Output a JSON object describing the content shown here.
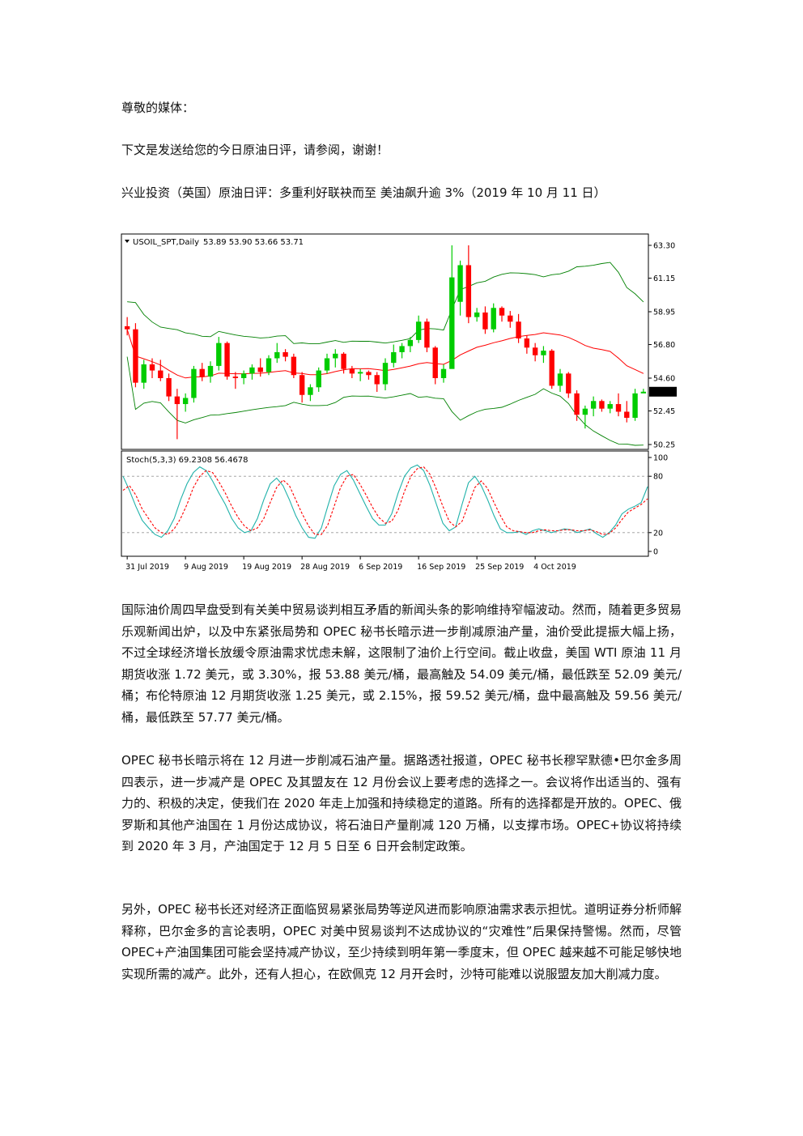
{
  "header": {
    "greeting": "尊敬的媒体：",
    "intro": "下文是发送给您的今日原油日评，请参阅，谢谢！",
    "title": "兴业投资（英国）原油日评：多重利好联袂而至  美油飙升逾 3%（2019 年 10 月 11 日）"
  },
  "chart_data": {
    "type": "candlestick",
    "symbol_label": "USOIL_SPT,Daily",
    "ohlc_label": "53.89 53.90 53.66 53.71",
    "price_ticks": [
      "63.30",
      "61.15",
      "58.95",
      "56.80",
      "54.60",
      "52.45",
      "50.25"
    ],
    "price_range": [
      50.25,
      63.3
    ],
    "current_price": "53.71",
    "date_labels": [
      "31 Jul 2019",
      "9 Aug 2019",
      "19 Aug 2019",
      "28 Aug 2019",
      "6 Sep 2019",
      "16 Sep 2019",
      "25 Sep 2019",
      "4 Oct 2019"
    ],
    "date_label_bar_index": [
      0,
      7,
      14,
      21,
      28,
      35,
      42,
      49
    ],
    "colors": {
      "up": "#00cc00",
      "down": "#ff0000",
      "bands": "#008000",
      "middle": "#ff0000",
      "stoch_main": "#20b2aa",
      "stoch_signal": "#ff0000"
    },
    "candles": [
      [
        58.0,
        58.6,
        57.4,
        57.8
      ],
      [
        57.8,
        58.2,
        54.0,
        54.3
      ],
      [
        54.3,
        55.8,
        53.9,
        55.5
      ],
      [
        55.5,
        55.9,
        54.6,
        55.1
      ],
      [
        55.1,
        55.8,
        54.4,
        54.6
      ],
      [
        54.6,
        54.9,
        53.1,
        53.4
      ],
      [
        53.4,
        53.9,
        50.6,
        52.9
      ],
      [
        52.9,
        53.6,
        52.4,
        53.3
      ],
      [
        53.3,
        55.4,
        53.0,
        55.2
      ],
      [
        55.2,
        55.6,
        54.4,
        54.7
      ],
      [
        54.7,
        55.7,
        54.3,
        55.4
      ],
      [
        55.4,
        57.3,
        55.1,
        56.9
      ],
      [
        56.9,
        57.0,
        54.5,
        54.7
      ],
      [
        54.7,
        55.0,
        53.9,
        54.6
      ],
      [
        54.6,
        55.1,
        54.2,
        54.9
      ],
      [
        54.9,
        55.5,
        54.5,
        55.3
      ],
      [
        55.3,
        55.9,
        54.7,
        55.0
      ],
      [
        55.0,
        56.1,
        54.8,
        55.9
      ],
      [
        55.9,
        56.9,
        55.6,
        56.3
      ],
      [
        56.3,
        56.5,
        55.7,
        56.0
      ],
      [
        56.0,
        56.2,
        54.6,
        54.8
      ],
      [
        54.8,
        55.0,
        53.0,
        53.5
      ],
      [
        53.5,
        54.2,
        53.1,
        54.0
      ],
      [
        54.0,
        55.3,
        53.7,
        55.1
      ],
      [
        55.1,
        56.2,
        54.9,
        55.9
      ],
      [
        55.9,
        56.5,
        55.3,
        56.2
      ],
      [
        56.2,
        56.3,
        54.9,
        55.2
      ],
      [
        55.2,
        55.4,
        54.6,
        54.9
      ],
      [
        54.9,
        55.2,
        54.4,
        55.0
      ],
      [
        55.0,
        55.1,
        54.5,
        54.8
      ],
      [
        54.8,
        55.0,
        53.7,
        54.2
      ],
      [
        54.2,
        55.9,
        53.8,
        55.6
      ],
      [
        55.6,
        56.8,
        55.3,
        56.3
      ],
      [
        56.3,
        56.9,
        55.9,
        56.7
      ],
      [
        56.7,
        57.3,
        56.3,
        57.1
      ],
      [
        57.1,
        58.7,
        56.9,
        58.3
      ],
      [
        58.3,
        58.5,
        56.3,
        56.6
      ],
      [
        56.6,
        56.7,
        54.2,
        54.6
      ],
      [
        54.6,
        55.5,
        54.3,
        55.2
      ],
      [
        55.2,
        63.3,
        60.5,
        61.2
      ],
      [
        59.6,
        62.3,
        58.7,
        62.0
      ],
      [
        62.0,
        63.3,
        58.2,
        58.6
      ],
      [
        58.6,
        59.2,
        58.3,
        58.9
      ],
      [
        58.9,
        59.3,
        57.5,
        57.8
      ],
      [
        57.8,
        59.5,
        57.6,
        59.2
      ],
      [
        59.2,
        59.3,
        58.3,
        58.7
      ],
      [
        58.7,
        59.0,
        57.9,
        58.3
      ],
      [
        58.3,
        58.8,
        56.9,
        57.2
      ],
      [
        57.2,
        57.4,
        56.2,
        56.6
      ],
      [
        56.6,
        56.9,
        55.7,
        56.1
      ],
      [
        56.1,
        56.7,
        55.6,
        56.4
      ],
      [
        56.4,
        56.5,
        53.9,
        54.1
      ],
      [
        54.1,
        55.2,
        53.7,
        54.9
      ],
      [
        54.9,
        55.0,
        53.3,
        53.6
      ],
      [
        53.6,
        53.8,
        51.8,
        52.2
      ],
      [
        52.2,
        52.8,
        51.3,
        52.6
      ],
      [
        52.6,
        53.4,
        52.1,
        53.1
      ],
      [
        53.1,
        53.2,
        52.4,
        52.6
      ],
      [
        52.6,
        53.1,
        52.3,
        52.9
      ],
      [
        52.9,
        53.6,
        52.1,
        52.4
      ],
      [
        52.4,
        53.1,
        51.7,
        52.0
      ],
      [
        52.0,
        53.9,
        51.8,
        53.6
      ],
      [
        53.6,
        53.9,
        53.66,
        53.71
      ]
    ],
    "stoch_label": "Stoch(5,3,3) 69.2308 56.4678",
    "stoch_ticks": [
      "100",
      "80",
      "20",
      "0"
    ],
    "stoch_levels": [
      80,
      20
    ],
    "stoch_main": [
      80,
      65,
      48,
      33,
      25,
      18,
      15,
      22,
      35,
      55,
      72,
      84,
      90,
      86,
      75,
      62,
      50,
      35,
      25,
      20,
      22,
      35,
      55,
      72,
      78,
      70,
      55,
      38,
      25,
      15,
      14,
      25,
      48,
      70,
      82,
      86,
      76,
      62,
      48,
      35,
      28,
      28,
      40,
      62,
      80,
      89,
      92,
      86,
      70,
      50,
      30,
      22,
      26,
      50,
      73,
      80,
      70,
      55,
      38,
      24,
      20,
      20,
      21,
      18,
      22,
      24,
      22,
      20,
      22,
      24,
      23,
      20,
      22,
      24,
      19,
      15,
      20,
      28,
      40,
      45,
      48,
      52,
      69
    ],
    "stoch_signal": [
      65,
      70,
      60,
      45,
      35,
      25,
      20,
      18,
      24,
      35,
      50,
      68,
      80,
      86,
      84,
      74,
      62,
      48,
      36,
      27,
      22,
      25,
      35,
      52,
      68,
      76,
      70,
      55,
      40,
      27,
      18,
      18,
      28,
      48,
      68,
      80,
      82,
      72,
      60,
      47,
      36,
      30,
      32,
      44,
      64,
      80,
      88,
      90,
      82,
      66,
      48,
      32,
      26,
      32,
      50,
      68,
      75,
      67,
      52,
      38,
      26,
      22,
      21,
      20,
      20,
      22,
      23,
      22,
      22,
      23,
      23,
      22,
      22,
      23,
      21,
      18,
      19,
      25,
      34,
      42,
      46,
      50,
      56
    ]
  },
  "paragraphs": [
    "国际油价周四早盘受到有关美中贸易谈判相互矛盾的新闻头条的影响维持窄幅波动。然而，随着更多贸易乐观新闻出炉，以及中东紧张局势和 OPEC 秘书长暗示进一步削减原油产量，油价受此提振大幅上扬，不过全球经济增长放缓令原油需求忧虑未解，这限制了油价上行空间。截止收盘，美国 WTI 原油 11 月期货收涨 1.72 美元，或 3.30%，报 53.88 美元/桶，最高触及 54.09 美元/桶，最低跌至 52.09 美元/桶；布伦特原油 12 月期货收涨 1.25 美元，或 2.15%，报 59.52 美元/桶，盘中最高触及 59.56 美元/桶，最低跌至 57.77 美元/桶。",
    "OPEC 秘书长暗示将在 12 月进一步削减石油产量。据路透社报道，OPEC 秘书长穆罕默德•巴尔金多周四表示，进一步减产是 OPEC 及其盟友在 12 月份会议上要考虑的选择之一。会议将作出适当的、强有力的、积极的决定，使我们在 2020 年走上加强和持续稳定的道路。所有的选择都是开放的。OPEC、俄罗斯和其他产油国在 1 月份达成协议，将石油日产量削减 120 万桶，以支撑市场。OPEC+协议将持续到 2020 年 3 月，产油国定于 12 月 5 日至 6 日开会制定政策。",
    "另外，OPEC 秘书长还对经济正面临贸易紧张局势等逆风进而影响原油需求表示担忧。道明证券分析师解释称，巴尔金多的言论表明，OPEC 对美中贸易谈判不达成协议的“灾难性”后果保持警惕。然而，尽管 OPEC+产油国集团可能会坚持减产协议，至少持续到明年第一季度末，但 OPEC 越来越不可能足够快地实现所需的减产。此外，还有人担心，在欧佩克 12 月开会时，沙特可能难以说服盟友加大削减力度。"
  ]
}
